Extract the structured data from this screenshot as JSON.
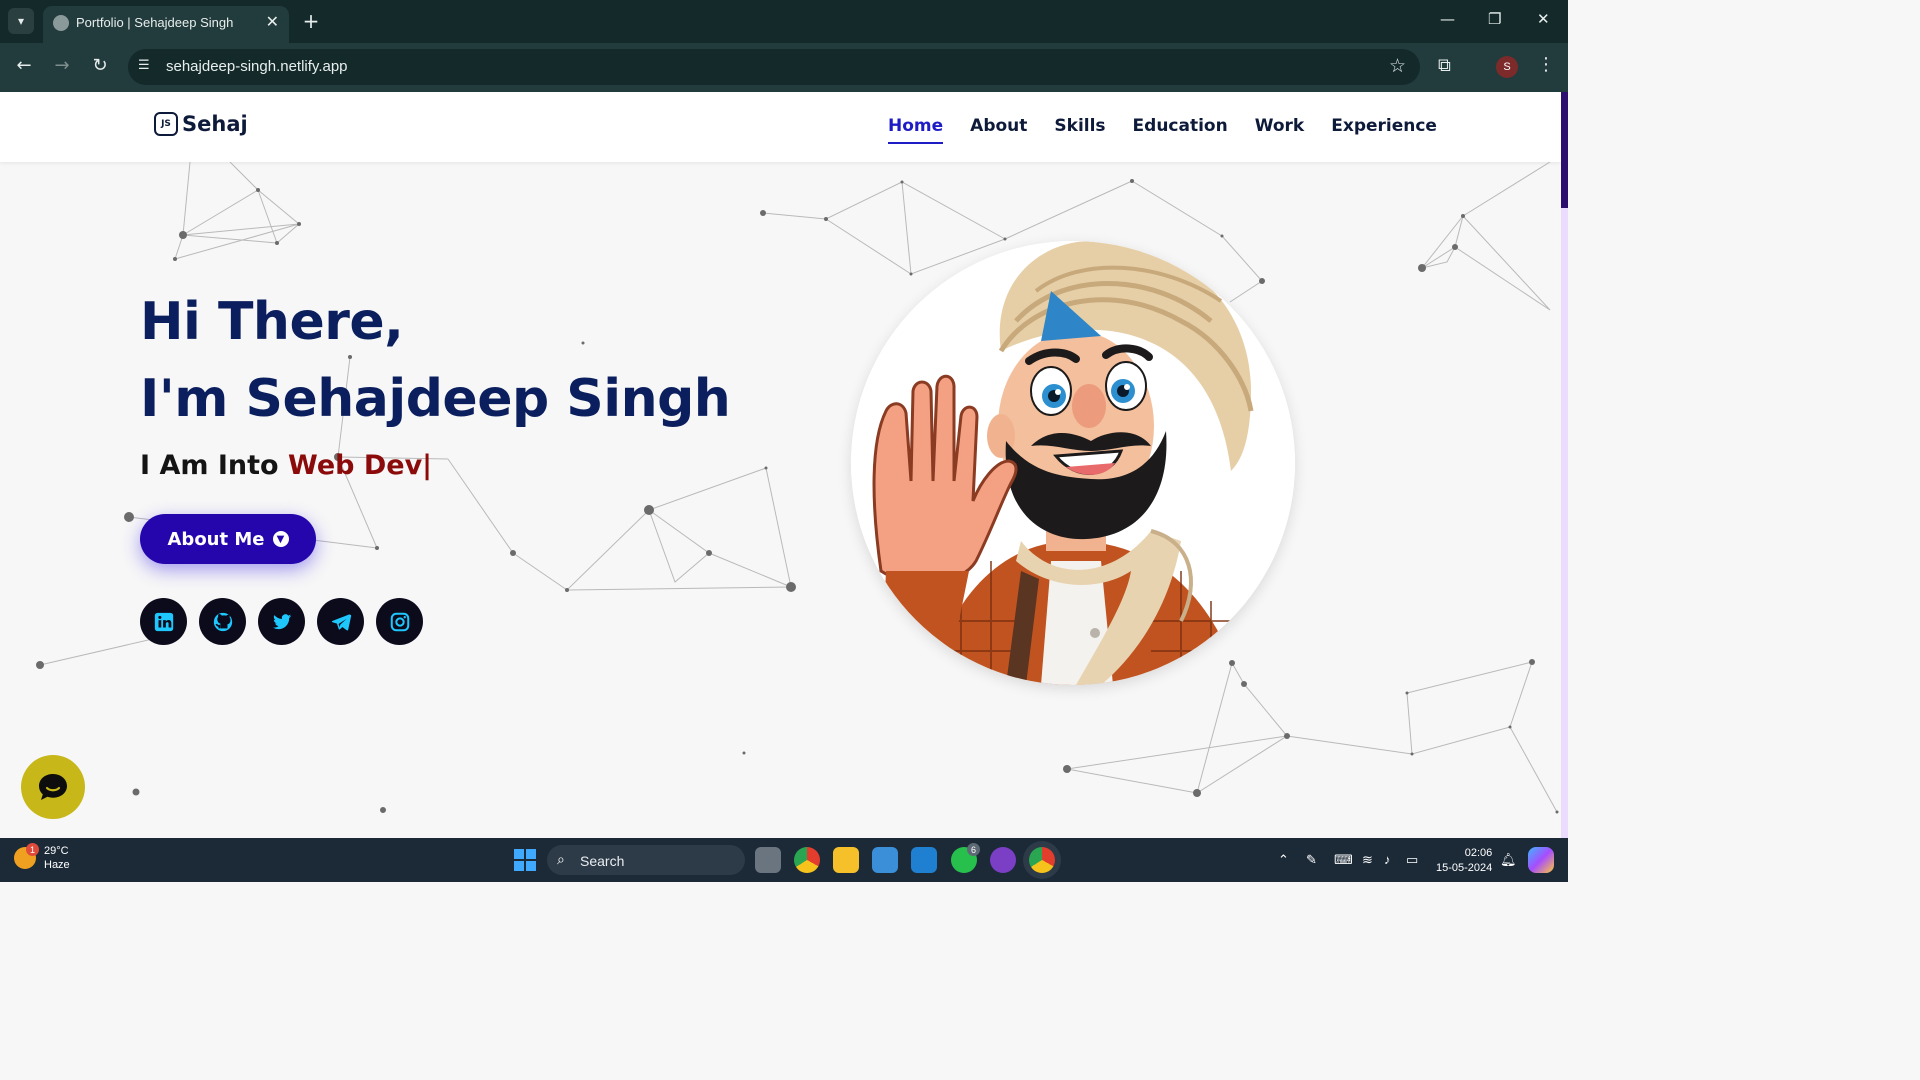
{
  "browser": {
    "tab_title": "Portfolio | Sehajdeep Singh",
    "tab_close": "✕",
    "new_tab": "+",
    "url": "sehajdeep-singh.netlify.app",
    "profile_initial": "S"
  },
  "site": {
    "logo_text": "Sehaj",
    "logo_mark": "JS",
    "nav": [
      {
        "label": "Home",
        "active": true
      },
      {
        "label": "About"
      },
      {
        "label": "Skills"
      },
      {
        "label": "Education"
      },
      {
        "label": "Work"
      },
      {
        "label": "Experience"
      }
    ]
  },
  "hero": {
    "greeting": "Hi There,",
    "name_line": "I'm Sehajdeep Singh",
    "into_prefix": "I Am Into ",
    "role": "Web Dev|",
    "button": "About Me",
    "socials": [
      "linkedin-icon",
      "github-icon",
      "twitter-icon",
      "telegram-icon",
      "instagram-icon"
    ]
  },
  "taskbar": {
    "weather_temp": "29°C",
    "weather_desc": "Haze",
    "weather_badge": "1",
    "search_label": "Search",
    "time": "02:06",
    "date": "15-05-2024",
    "whatsapp_badge": "6"
  },
  "colors": {
    "primary": "#0b1f5e",
    "accent_button": "#2506ad",
    "role_red": "#8b0a0a",
    "nav_active": "#1e1cc4"
  }
}
